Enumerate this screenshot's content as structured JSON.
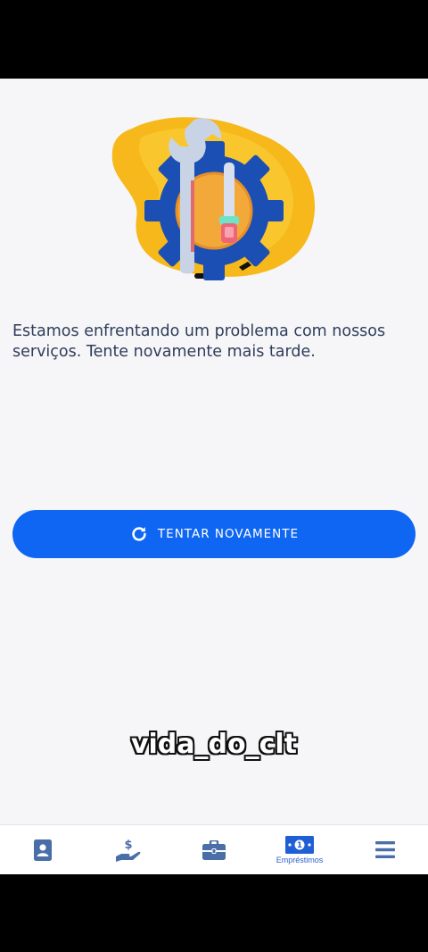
{
  "error": {
    "message": "Estamos enfrentando um problema com nossos serviços. Tente novamente mais tarde."
  },
  "actions": {
    "retry_label": "TENTAR NOVAMENTE"
  },
  "overlay": {
    "watermark": "vida_do_clt"
  },
  "bottom_nav": {
    "active": "Empréstimos",
    "items": [
      {
        "icon": "contact-card-icon",
        "label": ""
      },
      {
        "icon": "hand-dollar-icon",
        "label": ""
      },
      {
        "icon": "briefcase-icon",
        "label": ""
      },
      {
        "icon": "money-bill-icon",
        "label": "Empréstimos"
      },
      {
        "icon": "menu-icon",
        "label": ""
      }
    ]
  },
  "colors": {
    "primary": "#0f66f2",
    "text": "#2f3d5a",
    "nav_icon": "#4a6ea8",
    "background": "#f6f6f8"
  }
}
